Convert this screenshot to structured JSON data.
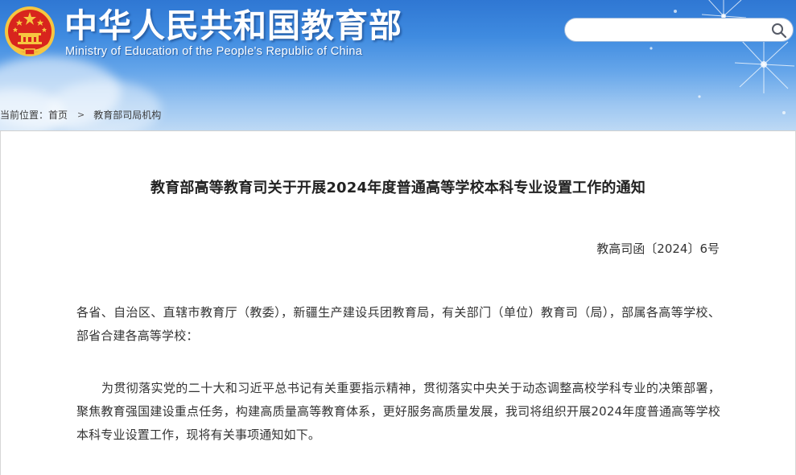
{
  "header": {
    "title_cn": "中华人民共和国教育部",
    "title_en": "Ministry of Education of the People's Republic of China",
    "emblem_icon": "national-emblem-icon",
    "search": {
      "value": "",
      "placeholder": "",
      "button_icon": "search-icon"
    }
  },
  "breadcrumb": {
    "prefix": "当前位置：",
    "items": [
      {
        "label": "首页"
      },
      {
        "label": "教育部司局机构"
      }
    ],
    "separator": ">"
  },
  "article": {
    "title": "教育部高等教育司关于开展2024年度普通高等学校本科专业设置工作的通知",
    "doc_number": "教高司函〔2024〕6号",
    "paragraphs": [
      "各省、自治区、直辖市教育厅（教委），新疆生产建设兵团教育局，有关部门（单位）教育司（局），部属各高等学校、部省合建各高等学校：",
      "为贯彻落实党的二十大和习近平总书记有关重要指示精神，贯彻落实中央关于动态调整高校学科专业的决策部署，聚焦教育强国建设重点任务，构建高质量高等教育体系，更好服务高质量发展，我司将组织开展2024年度普通高等学校本科专业设置工作，现将有关事项通知如下。"
    ]
  },
  "colors": {
    "banner_top": "#2f77d3",
    "banner_bottom": "#bdd9f5",
    "emblem_red": "#d8251d",
    "emblem_gold": "#f6c640",
    "text": "#333333",
    "title_text": "#222222"
  }
}
